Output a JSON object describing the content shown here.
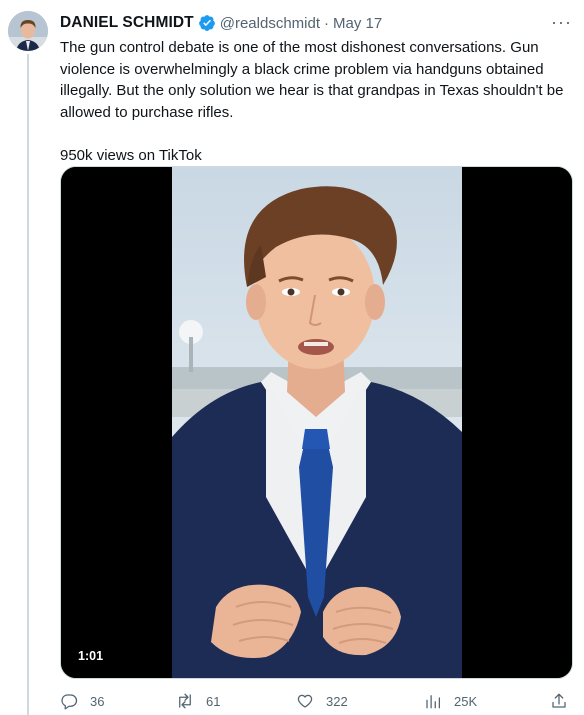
{
  "author": {
    "name": "DANIEL SCHMIDT",
    "handle": "@realdschmidt",
    "separator": "·",
    "date": "May 17",
    "verified": true
  },
  "tweet": {
    "text": "The gun control debate is one of the most dishonest conversations. Gun violence is overwhelmingly a black crime problem via handguns obtained illegally. But the only solution we hear is that grandpas in Texas shouldn't be allowed to purchase rifles.\n\n950k views on TikTok"
  },
  "media": {
    "duration": "1:01"
  },
  "actions": {
    "replies": "36",
    "retweets": "61",
    "likes": "322",
    "views": "25K"
  },
  "icons": {
    "more": "more-icon",
    "verified": "verified-badge-icon",
    "reply": "reply-icon",
    "retweet": "retweet-icon",
    "like": "heart-icon",
    "views": "views-icon",
    "share": "share-icon"
  },
  "colors": {
    "verified": "#1d9bf0",
    "muted": "#536471",
    "text": "#0f1419"
  }
}
